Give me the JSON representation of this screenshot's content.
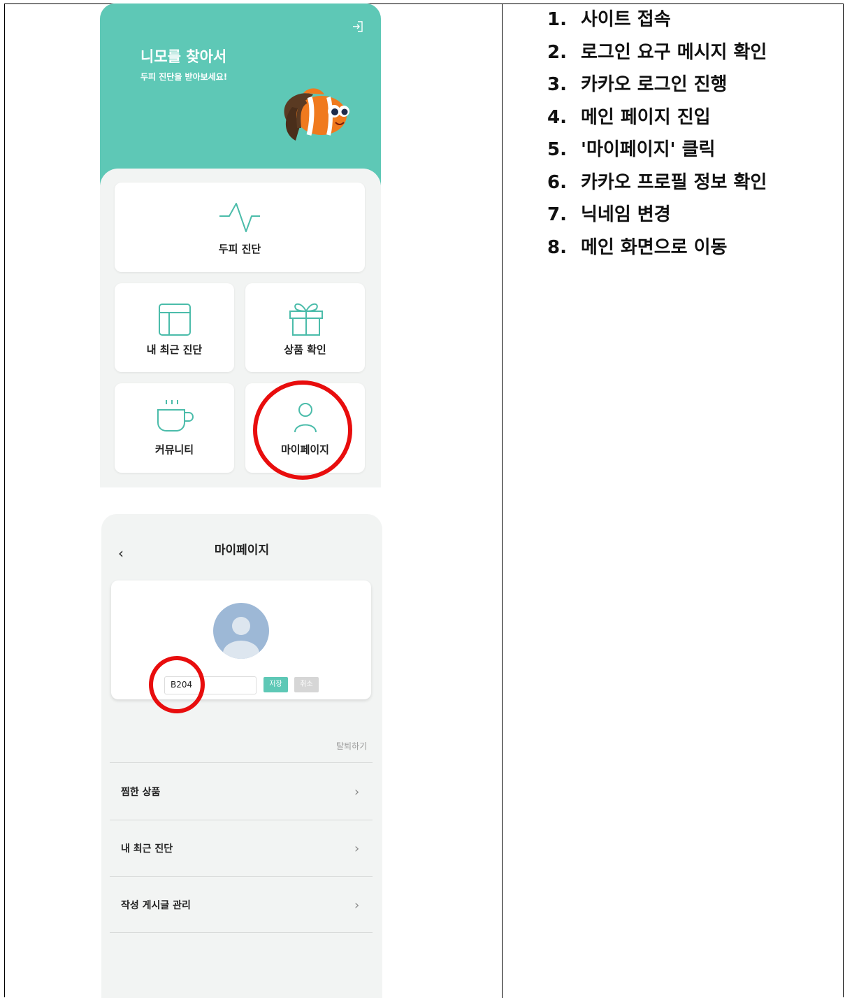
{
  "home": {
    "hero_title": "니모를 찾아서",
    "hero_subtitle": "두피 진단을 받아보세요!",
    "menu": {
      "diagnosis": "두피 진단",
      "recent": "내 최근 진단",
      "products": "상품 확인",
      "community": "커뮤니티",
      "mypage": "마이페이지"
    }
  },
  "mypage": {
    "title": "마이페이지",
    "back": "‹",
    "nickname_value": "B204",
    "save_label": "저장",
    "cancel_label": "취소",
    "withdraw_label": "탈퇴하기",
    "menu_items": [
      {
        "label": "찜한 상품",
        "chevron": "›"
      },
      {
        "label": "내 최근 진단",
        "chevron": "›"
      },
      {
        "label": "작성 게시글 관리",
        "chevron": "›"
      }
    ]
  },
  "steps": [
    {
      "num": "1.",
      "text": "사이트 접속"
    },
    {
      "num": "2.",
      "text": "로그인 요구 메시지 확인"
    },
    {
      "num": "3.",
      "text": "카카오 로그인 진행"
    },
    {
      "num": "4.",
      "text": "메인 페이지 진입"
    },
    {
      "num": "5.",
      "text": "'마이페이지' 클릭"
    },
    {
      "num": "6.",
      "text": "카카오 프로필 정보 확인"
    },
    {
      "num": "7.",
      "text": "닉네임 변경"
    },
    {
      "num": "8.",
      "text": "메인 화면으로 이동"
    }
  ],
  "colors": {
    "accent": "#5ec8b6",
    "highlight": "#e80d0d",
    "background": "#f2f4f3"
  }
}
